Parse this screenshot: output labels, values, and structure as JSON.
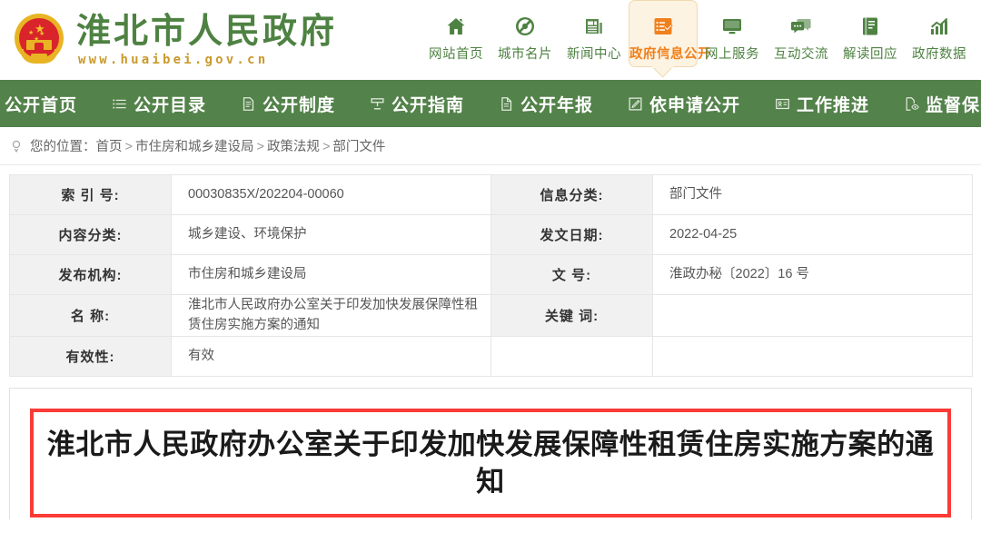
{
  "header": {
    "site_title": "淮北市人民政府",
    "site_url": "www.huaibei.gov.cn",
    "emblem_name": "national-emblem",
    "brand_color": "#4e8242",
    "url_color": "#c99a2e",
    "nav": [
      {
        "label": "网站首页",
        "icon": "home-icon",
        "active": false
      },
      {
        "label": "城市名片",
        "icon": "city-card-icon",
        "active": false
      },
      {
        "label": "新闻中心",
        "icon": "newspaper-icon",
        "active": false
      },
      {
        "label": "政府信息公开",
        "icon": "checklist-icon",
        "active": true
      },
      {
        "label": "网上服务",
        "icon": "monitor-icon",
        "active": false
      },
      {
        "label": "互动交流",
        "icon": "chat-icon",
        "active": false
      },
      {
        "label": "解读回应",
        "icon": "book-icon",
        "active": false
      },
      {
        "label": "政府数据",
        "icon": "chart-icon",
        "active": false
      }
    ]
  },
  "greenbar": {
    "background": "#53824a",
    "items": [
      {
        "label": "公开首页",
        "icon": "list-lines-icon"
      },
      {
        "label": "公开目录",
        "icon": "list-lines-icon"
      },
      {
        "label": "公开制度",
        "icon": "document-icon"
      },
      {
        "label": "公开指南",
        "icon": "signpost-icon"
      },
      {
        "label": "公开年报",
        "icon": "page-icon"
      },
      {
        "label": "依申请公开",
        "icon": "pencil-square-icon"
      },
      {
        "label": "工作推进",
        "icon": "id-card-icon"
      },
      {
        "label": "监督保障",
        "icon": "eye-document-icon"
      }
    ]
  },
  "breadcrumb": {
    "icon": "location-pin-icon",
    "prefix": "您的位置：",
    "items": [
      "首页",
      "市住房和城乡建设局",
      "政策法规",
      "部门文件"
    ],
    "separator": ">"
  },
  "info_table": {
    "rows": [
      {
        "left_label": "索 引 号:",
        "left_value": "00030835X/202204-00060",
        "right_label": "信息分类:",
        "right_value": "部门文件"
      },
      {
        "left_label": "内容分类:",
        "left_value": "城乡建设、环境保护",
        "right_label": "发文日期:",
        "right_value": "2022-04-25"
      },
      {
        "left_label": "发布机构:",
        "left_value": "市住房和城乡建设局",
        "right_label": "文    号:",
        "right_value": "淮政办秘〔2022〕16 号"
      },
      {
        "left_label": "名    称:",
        "left_value": "淮北市人民政府办公室关于印发加快发展保障性租赁住房实施方案的通知",
        "right_label": "关键 词:",
        "right_value": ""
      },
      {
        "left_label": "有效性:",
        "left_value": "有效",
        "right_label": "",
        "right_value": ""
      }
    ]
  },
  "document": {
    "title": "淮北市人民政府办公室关于印发加快发展保障性租赁住房实施方案的通知",
    "title_border_color": "#fb3b36"
  }
}
